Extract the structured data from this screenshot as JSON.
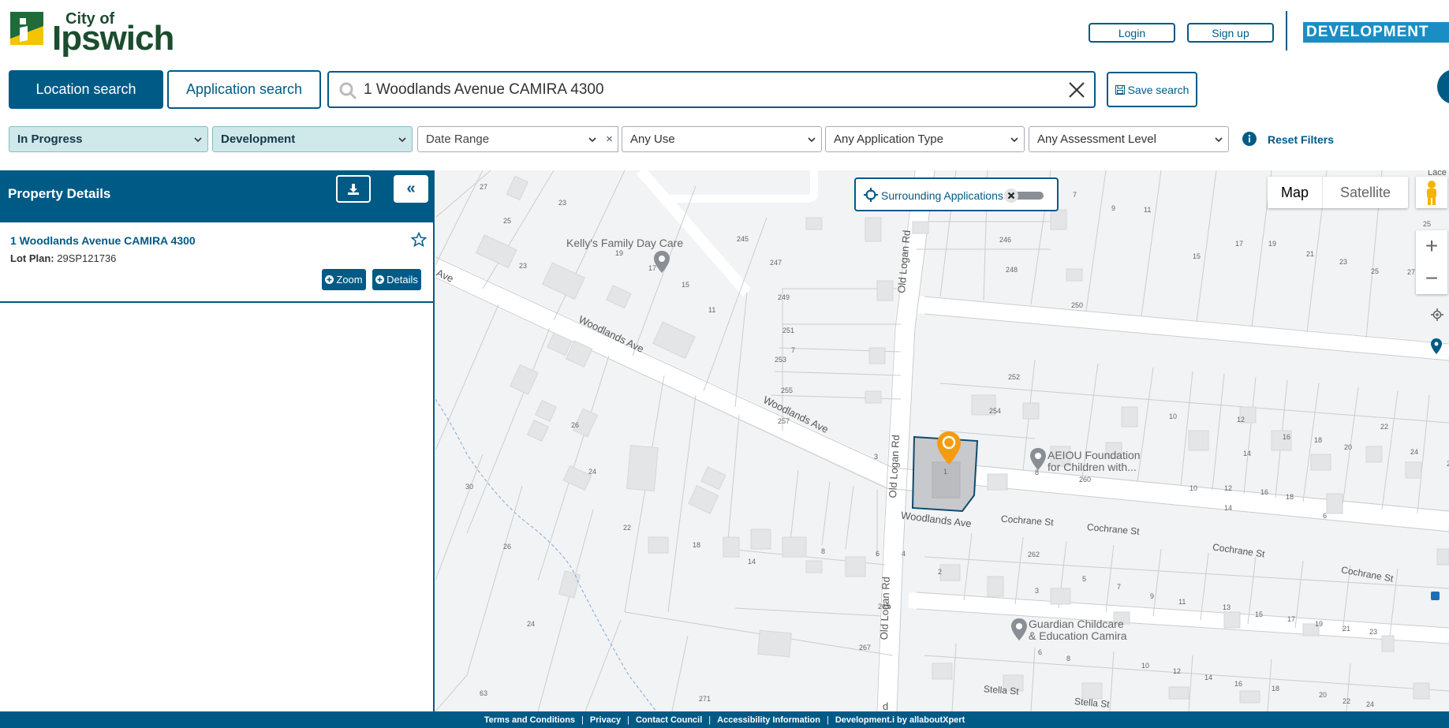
{
  "header": {
    "logo_top": "City of",
    "logo_main": "Ipswich",
    "login_label": "Login",
    "signup_label": "Sign up",
    "dev_logo": "DEVELOPMENT"
  },
  "search": {
    "tab_location": "Location search",
    "tab_application": "Application search",
    "value": "1 Woodlands Avenue CAMIRA 4300",
    "save_label": "Save search"
  },
  "filters": {
    "status": "In Progress",
    "type": "Development",
    "date": "Date Range",
    "date_clear": "×",
    "use": "Any Use",
    "app_type": "Any Application Type",
    "assessment": "Any Assessment Level",
    "reset": "Reset Filters"
  },
  "panel": {
    "title": "Property Details",
    "collapse": "«",
    "address": "1 Woodlands Avenue CAMIRA 4300",
    "lot_label": "Lot Plan:",
    "lot_value": "29SP121736",
    "zoom_label": "Zoom",
    "details_label": "Details"
  },
  "map": {
    "surrounding_label": "Surrounding Applications",
    "map_type_map": "Map",
    "map_type_satellite": "Satellite",
    "zoom_in": "+",
    "zoom_out": "−",
    "street_woodlands_1": "Woodlands Ave",
    "street_woodlands_2": "Woodlands Ave",
    "street_woodlands_3": "Woodlands Ave",
    "street_woodlands_cut": "s Ave",
    "street_oldlogan_1": "Old Logan Rd",
    "street_oldlogan_2": "Old Logan Rd",
    "street_oldlogan_3": "Old Logan Rd",
    "street_oldlogan_top": "Rd",
    "street_oldlogan_bottom": "d",
    "street_cochrane_1": "Cochrane St",
    "street_cochrane_2": "Cochrane St",
    "street_cochrane_3": "Cochrane St",
    "street_cochrane_4": "Cochrane St",
    "street_stella_1": "Stella St",
    "street_stella_2": "Stella St",
    "street_lace": "Lace",
    "poi_kelly": "Kelly's Family Day Care",
    "poi_aeiou_1": "AEIOU Foundation",
    "poi_aeiou_2": "for Children with...",
    "poi_guardian_1": "Guardian Childcare",
    "poi_guardian_2": "& Education Camira",
    "lots": [
      "27",
      "23",
      "25",
      "23",
      "19",
      "17",
      "15",
      "11",
      "7",
      "26",
      "24",
      "22",
      "26",
      "24",
      "18",
      "14",
      "8",
      "6",
      "4",
      "2",
      "265",
      "267",
      "271",
      "63",
      "30",
      "245",
      "247",
      "249",
      "251",
      "253",
      "255",
      "257",
      "3",
      "1",
      "246",
      "248",
      "250",
      "252",
      "254",
      "7",
      "9",
      "11",
      "15",
      "17",
      "19",
      "21",
      "23",
      "25",
      "27",
      "25",
      "10",
      "12",
      "14",
      "16",
      "18",
      "20",
      "22",
      "24",
      "26",
      "10",
      "12",
      "14",
      "16",
      "18",
      "6",
      "8",
      "260",
      "262",
      "3",
      "5",
      "7",
      "9",
      "11",
      "13",
      "15",
      "17",
      "19",
      "21",
      "23",
      "6",
      "8",
      "10",
      "12",
      "14",
      "16",
      "18",
      "20",
      "22",
      "24"
    ]
  },
  "footer": {
    "terms": "Terms and Conditions",
    "privacy": "Privacy",
    "contact": "Contact Council",
    "accessibility": "Accessibility Information",
    "vendor": "Development.i by allaboutXpert",
    "sep": "|"
  },
  "colors": {
    "brand": "#005a86",
    "filter_active": "#cfe8ea",
    "marker": "#f39c12"
  }
}
